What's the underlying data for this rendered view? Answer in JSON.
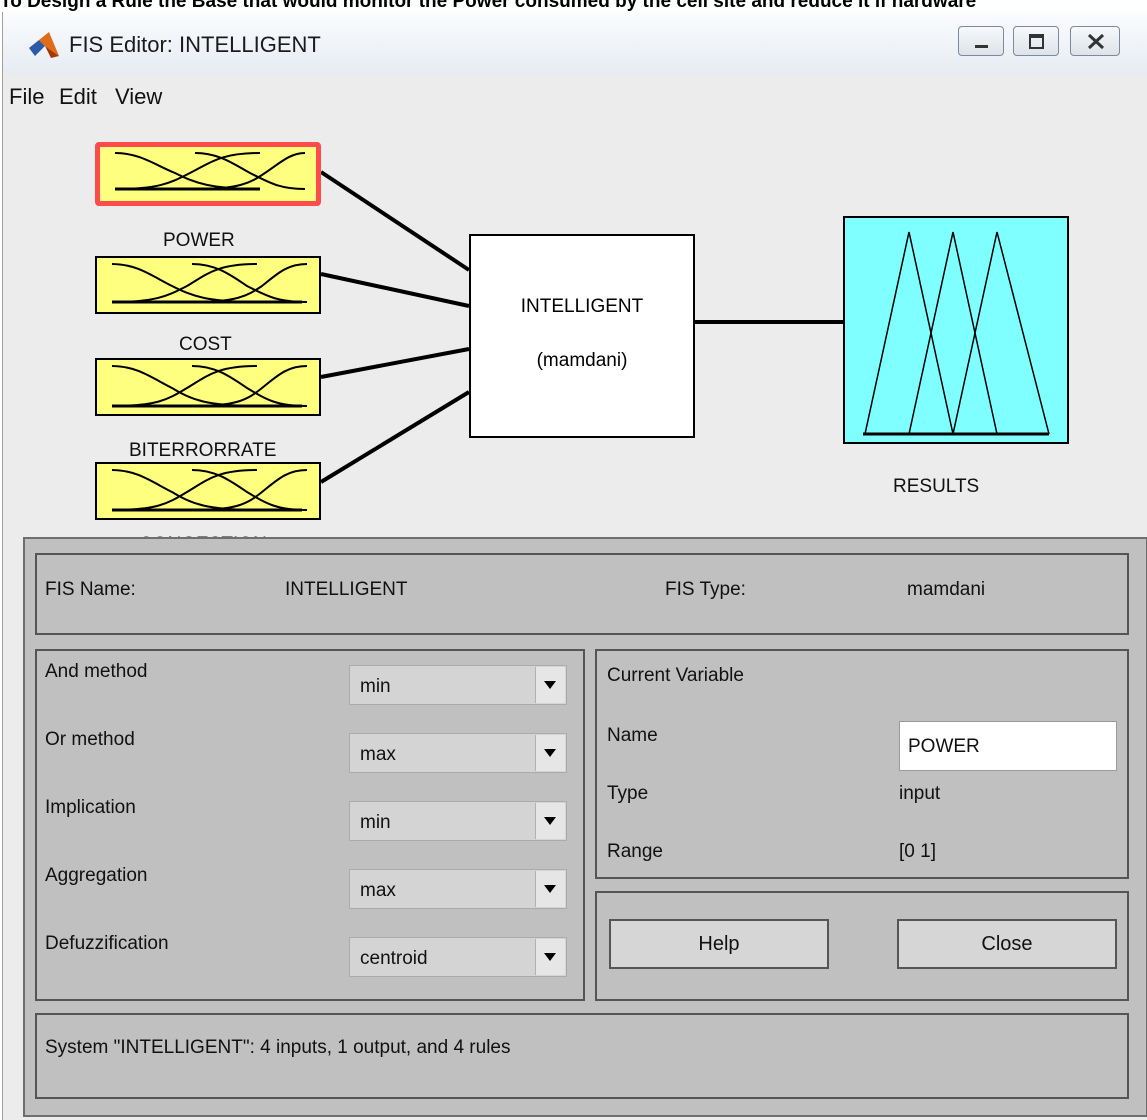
{
  "doc_caption": "To Design a Rule the Base that would monitor the Power consumed by the cell site and reduce it if hardware",
  "window": {
    "title": "FIS Editor: INTELLIGENT"
  },
  "menu": [
    "File",
    "Edit",
    "View"
  ],
  "inputs": [
    {
      "name": "POWER"
    },
    {
      "name": "COST"
    },
    {
      "name": "BITERRORRATE"
    },
    {
      "name": "CONGESTION"
    }
  ],
  "system_block": {
    "name": "INTELLIGENT",
    "type_label": "(mamdani)"
  },
  "output": {
    "name": "RESULTS"
  },
  "fis_info": {
    "name_label": "FIS Name:",
    "name_value": "INTELLIGENT",
    "type_label": "FIS Type:",
    "type_value": "mamdani"
  },
  "methods": [
    {
      "label": "And method",
      "value": "min"
    },
    {
      "label": "Or method",
      "value": "max"
    },
    {
      "label": "Implication",
      "value": "min"
    },
    {
      "label": "Aggregation",
      "value": "max"
    },
    {
      "label": "Defuzzification",
      "value": "centroid"
    }
  ],
  "current_variable": {
    "heading": "Current Variable",
    "name_label": "Name",
    "name_value": "POWER",
    "type_label": "Type",
    "type_value": "input",
    "range_label": "Range",
    "range_value": "[0 1]"
  },
  "buttons": {
    "help": "Help",
    "close": "Close"
  },
  "status": "System \"INTELLIGENT\": 4 inputs, 1 output, and 4 rules",
  "colors": {
    "input_fill": "#ffff7f",
    "output_fill": "#7fffff",
    "selected_border": "#ff4b4b",
    "panel": "#c0c0c0"
  }
}
